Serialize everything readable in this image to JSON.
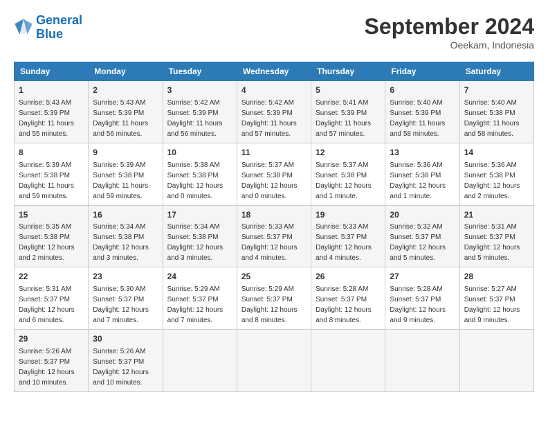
{
  "header": {
    "logo_line1": "General",
    "logo_line2": "Blue",
    "month_title": "September 2024",
    "location": "Oeekam, Indonesia"
  },
  "days_of_week": [
    "Sunday",
    "Monday",
    "Tuesday",
    "Wednesday",
    "Thursday",
    "Friday",
    "Saturday"
  ],
  "weeks": [
    [
      {
        "day": "1",
        "sunrise": "5:43 AM",
        "sunset": "5:39 PM",
        "daylight": "11 hours and 55 minutes."
      },
      {
        "day": "2",
        "sunrise": "5:43 AM",
        "sunset": "5:39 PM",
        "daylight": "11 hours and 56 minutes."
      },
      {
        "day": "3",
        "sunrise": "5:42 AM",
        "sunset": "5:39 PM",
        "daylight": "11 hours and 56 minutes."
      },
      {
        "day": "4",
        "sunrise": "5:42 AM",
        "sunset": "5:39 PM",
        "daylight": "11 hours and 57 minutes."
      },
      {
        "day": "5",
        "sunrise": "5:41 AM",
        "sunset": "5:39 PM",
        "daylight": "11 hours and 57 minutes."
      },
      {
        "day": "6",
        "sunrise": "5:40 AM",
        "sunset": "5:39 PM",
        "daylight": "11 hours and 58 minutes."
      },
      {
        "day": "7",
        "sunrise": "5:40 AM",
        "sunset": "5:38 PM",
        "daylight": "11 hours and 58 minutes."
      }
    ],
    [
      {
        "day": "8",
        "sunrise": "5:39 AM",
        "sunset": "5:38 PM",
        "daylight": "11 hours and 59 minutes."
      },
      {
        "day": "9",
        "sunrise": "5:39 AM",
        "sunset": "5:38 PM",
        "daylight": "11 hours and 59 minutes."
      },
      {
        "day": "10",
        "sunrise": "5:38 AM",
        "sunset": "5:38 PM",
        "daylight": "12 hours and 0 minutes."
      },
      {
        "day": "11",
        "sunrise": "5:37 AM",
        "sunset": "5:38 PM",
        "daylight": "12 hours and 0 minutes."
      },
      {
        "day": "12",
        "sunrise": "5:37 AM",
        "sunset": "5:38 PM",
        "daylight": "12 hours and 1 minute."
      },
      {
        "day": "13",
        "sunrise": "5:36 AM",
        "sunset": "5:38 PM",
        "daylight": "12 hours and 1 minute."
      },
      {
        "day": "14",
        "sunrise": "5:36 AM",
        "sunset": "5:38 PM",
        "daylight": "12 hours and 2 minutes."
      }
    ],
    [
      {
        "day": "15",
        "sunrise": "5:35 AM",
        "sunset": "5:38 PM",
        "daylight": "12 hours and 2 minutes."
      },
      {
        "day": "16",
        "sunrise": "5:34 AM",
        "sunset": "5:38 PM",
        "daylight": "12 hours and 3 minutes."
      },
      {
        "day": "17",
        "sunrise": "5:34 AM",
        "sunset": "5:38 PM",
        "daylight": "12 hours and 3 minutes."
      },
      {
        "day": "18",
        "sunrise": "5:33 AM",
        "sunset": "5:37 PM",
        "daylight": "12 hours and 4 minutes."
      },
      {
        "day": "19",
        "sunrise": "5:33 AM",
        "sunset": "5:37 PM",
        "daylight": "12 hours and 4 minutes."
      },
      {
        "day": "20",
        "sunrise": "5:32 AM",
        "sunset": "5:37 PM",
        "daylight": "12 hours and 5 minutes."
      },
      {
        "day": "21",
        "sunrise": "5:31 AM",
        "sunset": "5:37 PM",
        "daylight": "12 hours and 5 minutes."
      }
    ],
    [
      {
        "day": "22",
        "sunrise": "5:31 AM",
        "sunset": "5:37 PM",
        "daylight": "12 hours and 6 minutes."
      },
      {
        "day": "23",
        "sunrise": "5:30 AM",
        "sunset": "5:37 PM",
        "daylight": "12 hours and 7 minutes."
      },
      {
        "day": "24",
        "sunrise": "5:29 AM",
        "sunset": "5:37 PM",
        "daylight": "12 hours and 7 minutes."
      },
      {
        "day": "25",
        "sunrise": "5:29 AM",
        "sunset": "5:37 PM",
        "daylight": "12 hours and 8 minutes."
      },
      {
        "day": "26",
        "sunrise": "5:28 AM",
        "sunset": "5:37 PM",
        "daylight": "12 hours and 8 minutes."
      },
      {
        "day": "27",
        "sunrise": "5:28 AM",
        "sunset": "5:37 PM",
        "daylight": "12 hours and 9 minutes."
      },
      {
        "day": "28",
        "sunrise": "5:27 AM",
        "sunset": "5:37 PM",
        "daylight": "12 hours and 9 minutes."
      }
    ],
    [
      {
        "day": "29",
        "sunrise": "5:26 AM",
        "sunset": "5:37 PM",
        "daylight": "12 hours and 10 minutes."
      },
      {
        "day": "30",
        "sunrise": "5:26 AM",
        "sunset": "5:37 PM",
        "daylight": "12 hours and 10 minutes."
      },
      null,
      null,
      null,
      null,
      null
    ]
  ]
}
